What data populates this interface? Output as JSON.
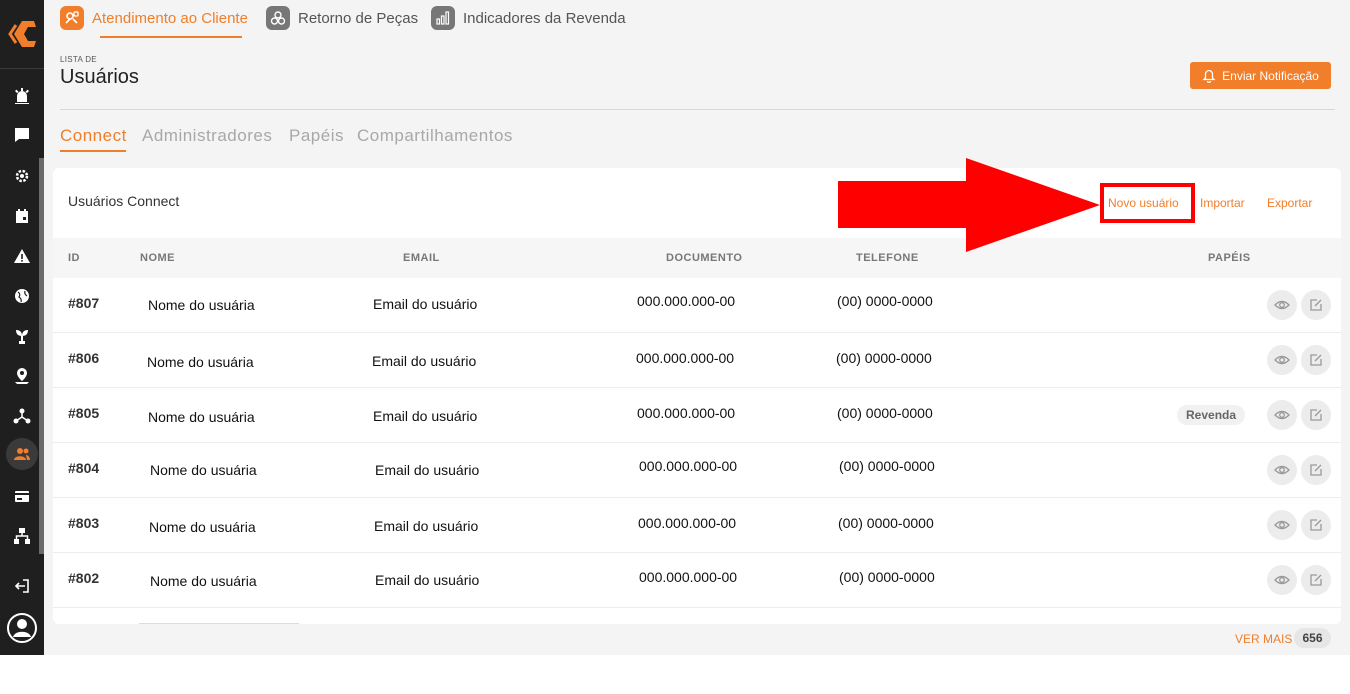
{
  "colors": {
    "accent": "#f07e2a",
    "sidebar_bg": "#1f1f1f",
    "annotation": "#ff0000"
  },
  "top_tabs": [
    {
      "label": "Atendimento ao Cliente",
      "icon": "customer-service-icon",
      "active": true
    },
    {
      "label": "Retorno de Peças",
      "icon": "parts-return-icon",
      "active": false
    },
    {
      "label": "Indicadores da Revenda",
      "icon": "bar-chart-icon",
      "active": false
    }
  ],
  "sidebar": {
    "logo": "brand-logo",
    "icons": [
      "alarm-icon",
      "chat-icon",
      "settings-cog-icon",
      "calendar-icon",
      "warning-icon",
      "globe-icon",
      "plant-icon",
      "map-pin-icon",
      "network-icon",
      "users-icon",
      "credit-card-icon",
      "sitemap-icon",
      "logout-icon",
      "profile-icon"
    ],
    "active": "users-icon"
  },
  "page": {
    "caption": "LISTA DE",
    "title": "Usuários"
  },
  "notify_button": {
    "label": "Enviar Notificação",
    "icon": "bell-icon"
  },
  "subtabs": [
    {
      "label": "Connect",
      "active": true
    },
    {
      "label": "Administradores",
      "active": false
    },
    {
      "label": "Papéis",
      "active": false
    },
    {
      "label": "Compartilhamentos",
      "active": false
    }
  ],
  "card": {
    "title": "Usuários Connect",
    "new_user": "Novo usuário",
    "import": "Importar",
    "export": "Exportar"
  },
  "table": {
    "headers": {
      "id": "ID",
      "name": "NOME",
      "email": "EMAIL",
      "document": "DOCUMENTO",
      "phone": "TELEFONE",
      "roles": "PAPÉIS"
    },
    "rows": [
      {
        "id": "#807",
        "name": "Nome do usuária",
        "email": "Email do usuário",
        "document": "000.000.000-00",
        "phone": "(00) 0000-0000",
        "role": ""
      },
      {
        "id": "#806",
        "name": "Nome do usuária",
        "email": "Email do usuário",
        "document": "000.000.000-00",
        "phone": "(00) 0000-0000",
        "role": ""
      },
      {
        "id": "#805",
        "name": "Nome do usuária",
        "email": "Email do usuário",
        "document": "000.000.000-00",
        "phone": "(00) 0000-0000",
        "role": "Revenda"
      },
      {
        "id": "#804",
        "name": "Nome do usuária",
        "email": "Email do usuário",
        "document": "000.000.000-00",
        "phone": "(00) 0000-0000",
        "role": ""
      },
      {
        "id": "#803",
        "name": "Nome do usuária",
        "email": "Email do usuário",
        "document": "000.000.000-00",
        "phone": "(00) 0000-0000",
        "role": ""
      },
      {
        "id": "#802",
        "name": "Nome do usuária",
        "email": "Email do usuário",
        "document": "000.000.000-00",
        "phone": "(00) 0000-0000",
        "role": ""
      }
    ]
  },
  "footer": {
    "see_more": "VER MAIS",
    "total": "656"
  }
}
